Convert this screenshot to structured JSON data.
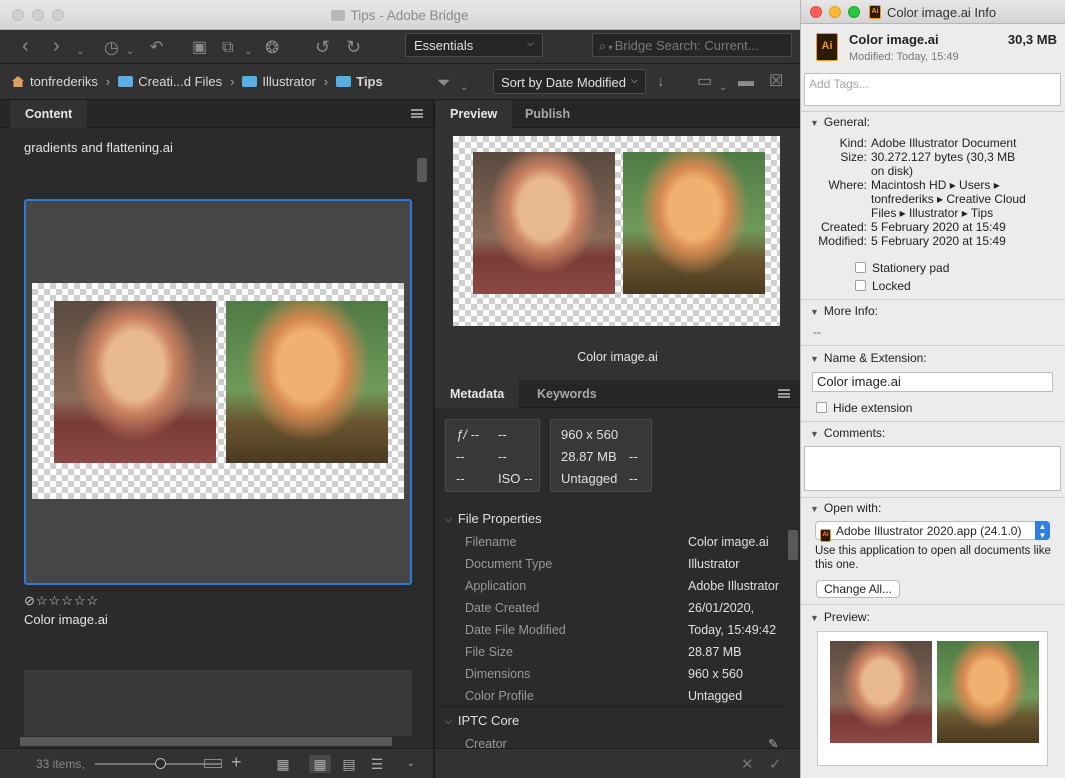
{
  "bridge": {
    "window_title": "Tips - Adobe Bridge",
    "workspace": "Essentials",
    "search_placeholder": "Bridge Search: Current...",
    "breadcrumb": [
      "tonfrederiks",
      "Creati...d Files",
      "Illustrator",
      "Tips"
    ],
    "sort_label": "Sort by Date Modified",
    "content_tab": "Content",
    "folder_item": "gradients and flattening.ai",
    "selected_item": "Color image.ai",
    "rating_stars": 0,
    "status_count": "33 items,",
    "preview_tabs": [
      "Preview",
      "Publish"
    ],
    "preview_caption": "Color image.ai",
    "metadata_tabs": [
      "Metadata",
      "Keywords"
    ],
    "camera_data": {
      "fstop": "ƒ/ --",
      "shutter": "--",
      "c3": "--",
      "c4": "--",
      "c5": "--",
      "iso": "ISO --"
    },
    "image_data": {
      "dimensions": "960 x 560",
      "size": "28.87 MB",
      "profile": "Untagged",
      "d1": "--",
      "d2": "--"
    },
    "file_properties_title": "File Properties",
    "file_properties": [
      {
        "key": "Filename",
        "value": "Color image.ai"
      },
      {
        "key": "Document Type",
        "value": "Illustrator"
      },
      {
        "key": "Application",
        "value": "Adobe Illustrator"
      },
      {
        "key": "Date Created",
        "value": "26/01/2020,"
      },
      {
        "key": "Date File Modified",
        "value": "Today, 15:49:42"
      },
      {
        "key": "File Size",
        "value": "28.87 MB"
      },
      {
        "key": "Dimensions",
        "value": "960 x 560"
      },
      {
        "key": "Color Profile",
        "value": "Untagged"
      }
    ],
    "iptc_title": "IPTC Core",
    "iptc_first": "Creator"
  },
  "info": {
    "window_title": "Color image.ai Info",
    "file_name": "Color image.ai",
    "file_size": "30,3 MB",
    "modified_line": "Modified: Today, 15:49",
    "tags_placeholder": "Add Tags...",
    "general_title": "General:",
    "general": [
      {
        "key": "Kind:",
        "value": "Adobe Illustrator Document"
      },
      {
        "key": "Size:",
        "value": "30.272.127 bytes (30,3 MB on disk)"
      },
      {
        "key": "Where:",
        "value": "Macintosh HD ▸ Users ▸ tonfrederiks ▸ Creative Cloud Files ▸ Illustrator ▸ Tips"
      },
      {
        "key": "Created:",
        "value": "5 February 2020 at 15:49"
      },
      {
        "key": "Modified:",
        "value": "5 February 2020 at 15:49"
      }
    ],
    "stationery": "Stationery pad",
    "locked": "Locked",
    "more_info_title": "More Info:",
    "more_info_value": "--",
    "name_ext_title": "Name & Extension:",
    "name_value": "Color image.ai",
    "hide_ext": "Hide extension",
    "comments_title": "Comments:",
    "open_with_title": "Open with:",
    "open_with_app": "Adobe Illustrator 2020.app (24.1.0)",
    "open_with_note": "Use this application to open all documents like this one.",
    "change_all": "Change All...",
    "preview_title": "Preview:"
  }
}
